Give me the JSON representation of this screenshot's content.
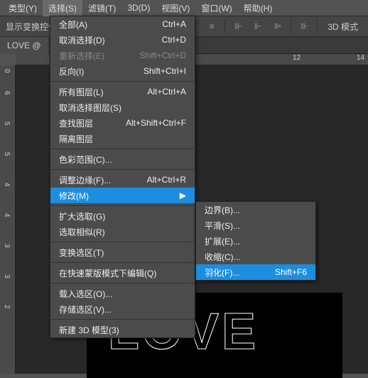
{
  "menubar": {
    "items": [
      {
        "label": "类型(Y)"
      },
      {
        "label": "选择(S)"
      },
      {
        "label": "滤镜(T)"
      },
      {
        "label": "3D(D)"
      },
      {
        "label": "视图(V)"
      },
      {
        "label": "窗口(W)"
      },
      {
        "label": "帮助(H)"
      }
    ]
  },
  "toolbar": {
    "label": "显示变换控件",
    "btn3d": "3D 模式"
  },
  "tab": {
    "title": "LOVE @"
  },
  "ruler_h": [
    "12",
    "14"
  ],
  "ruler_v": [
    "0",
    "6",
    "5",
    "5",
    "4",
    "4",
    "3",
    "3",
    "2"
  ],
  "dropdown": {
    "items": [
      {
        "label": "全部(A)",
        "shortcut": "Ctrl+A"
      },
      {
        "label": "取消选择(D)",
        "shortcut": "Ctrl+D"
      },
      {
        "label": "重新选择(E)",
        "shortcut": "Shift+Ctrl+D",
        "disabled": true
      },
      {
        "label": "反向(I)",
        "shortcut": "Shift+Ctrl+I"
      },
      {
        "sep": true
      },
      {
        "label": "所有图层(L)",
        "shortcut": "Alt+Ctrl+A"
      },
      {
        "label": "取消选择图层(S)"
      },
      {
        "label": "查找图层",
        "shortcut": "Alt+Shift+Ctrl+F"
      },
      {
        "label": "隔离图层"
      },
      {
        "sep": true
      },
      {
        "label": "色彩范围(C)..."
      },
      {
        "sep": true
      },
      {
        "label": "调整边缘(F)...",
        "shortcut": "Alt+Ctrl+R"
      },
      {
        "label": "修改(M)",
        "submenu": true,
        "highlight": true
      },
      {
        "sep": true
      },
      {
        "label": "扩大选取(G)"
      },
      {
        "label": "选取相似(R)"
      },
      {
        "sep": true
      },
      {
        "label": "变换选区(T)"
      },
      {
        "sep": true
      },
      {
        "label": "在快速蒙版模式下编辑(Q)"
      },
      {
        "sep": true
      },
      {
        "label": "载入选区(O)..."
      },
      {
        "label": "存储选区(V)..."
      },
      {
        "sep": true
      },
      {
        "label": "新建 3D 模型(3)"
      }
    ]
  },
  "submenu": {
    "items": [
      {
        "label": "边界(B)..."
      },
      {
        "label": "平滑(S)..."
      },
      {
        "label": "扩展(E)..."
      },
      {
        "label": "收缩(C)..."
      },
      {
        "label": "羽化(F)...",
        "shortcut": "Shift+F6",
        "highlight": true
      }
    ]
  },
  "artwork": {
    "text": "LOVE"
  }
}
